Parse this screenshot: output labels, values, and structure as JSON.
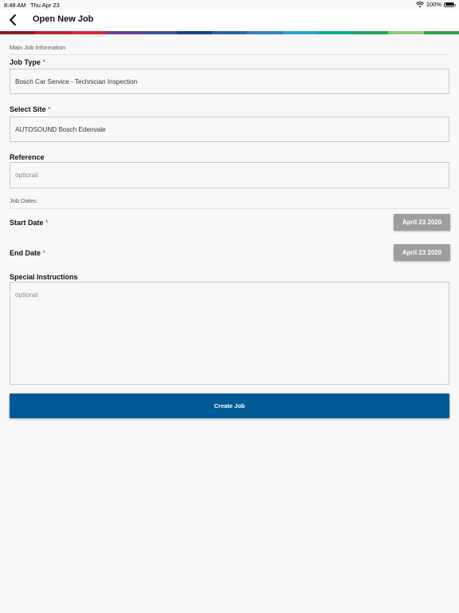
{
  "status_bar": {
    "time": "8:48 AM",
    "date": "Thu Apr 23",
    "battery": "100%"
  },
  "header": {
    "title": "Open New Job"
  },
  "brand_colors": [
    "#8b1a2b",
    "#c0202f",
    "#d6263a",
    "#6b3f98",
    "#3e4fa0",
    "#1b3f8f",
    "#2a5fb0",
    "#2f7ec1",
    "#26a3d2",
    "#14a89a",
    "#22a453",
    "#8fc97a",
    "#2e9e4a"
  ],
  "sections": {
    "main_info": "Main Job Information",
    "job_dates": "Job Dates"
  },
  "fields": {
    "job_type": {
      "label": "Job Type",
      "required_mark": "*",
      "value": "Bosch Car Service - Technician Inspection"
    },
    "select_site": {
      "label": "Select Site",
      "required_mark": "*",
      "value": "AUTOSOUND Bosch Edenvale"
    },
    "reference": {
      "label": "Reference",
      "placeholder": "optional"
    },
    "start_date": {
      "label": "Start Date",
      "required_mark": "*",
      "value": "April 23 2020"
    },
    "end_date": {
      "label": "End Date",
      "required_mark": "*",
      "value": "April 23 2020"
    },
    "special_instructions": {
      "label": "Special Instructions",
      "placeholder": "optional"
    }
  },
  "actions": {
    "create_job": "Create Job"
  },
  "icons": {
    "back": "chevron-left-icon",
    "wifi": "wifi-icon",
    "battery": "battery-icon"
  }
}
